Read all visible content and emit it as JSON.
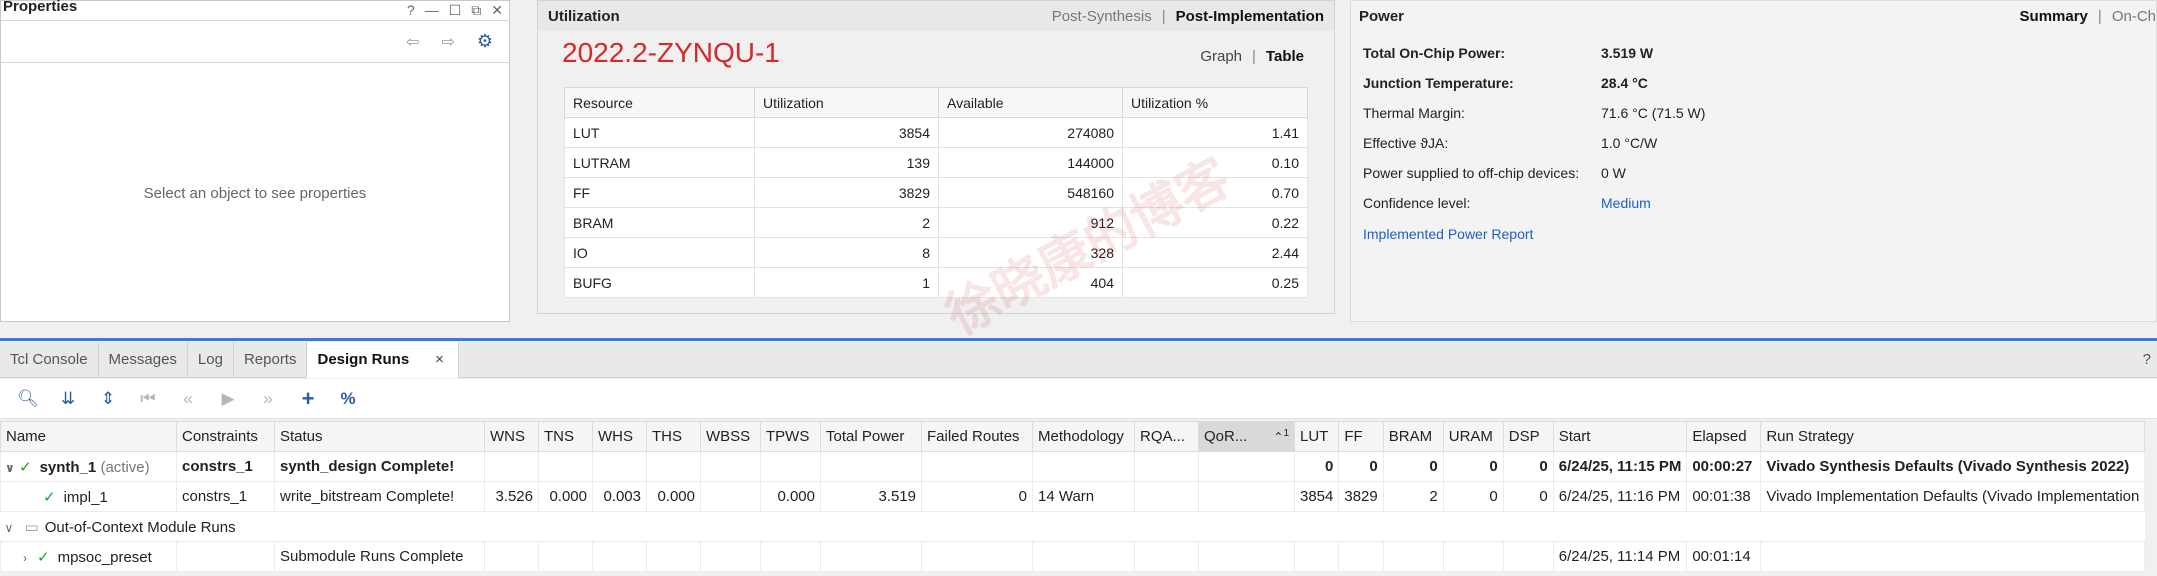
{
  "properties": {
    "title": "Properties",
    "window_controls": [
      "?",
      "—",
      "☐",
      "⧉",
      "✕"
    ],
    "empty_message": "Select an object to see properties"
  },
  "utilization": {
    "title": "Utilization",
    "modes": [
      "Post-Synthesis",
      "Post-Implementation"
    ],
    "device": "2022.2-ZYNQU-1",
    "views": [
      "Graph",
      "Table"
    ],
    "columns": [
      "Resource",
      "Utilization",
      "Available",
      "Utilization %"
    ],
    "rows": [
      [
        "LUT",
        "3854",
        "274080",
        "1.41"
      ],
      [
        "LUTRAM",
        "139",
        "144000",
        "0.10"
      ],
      [
        "FF",
        "3829",
        "548160",
        "0.70"
      ],
      [
        "BRAM",
        "2",
        "912",
        "0.22"
      ],
      [
        "IO",
        "8",
        "328",
        "2.44"
      ],
      [
        "BUFG",
        "1",
        "404",
        "0.25"
      ]
    ]
  },
  "power": {
    "title": "Power",
    "views": [
      "Summary",
      "On-Ch"
    ],
    "rows": [
      {
        "k": "Total On-Chip Power:",
        "v": "3.519 W",
        "bold": true
      },
      {
        "k": "Junction Temperature:",
        "v": "28.4 °C",
        "bold": true
      },
      {
        "k": "Thermal Margin:",
        "v": "71.6 °C (71.5 W)"
      },
      {
        "k": "Effective ϑJA:",
        "v": "1.0 °C/W"
      },
      {
        "k": "Power supplied to off-chip devices:",
        "v": "0 W"
      },
      {
        "k": "Confidence level:",
        "v": "Medium",
        "link": true
      }
    ],
    "report_link": "Implemented Power Report"
  },
  "tabs": [
    "Tcl Console",
    "Messages",
    "Log",
    "Reports",
    "Design Runs"
  ],
  "tab_close": "×",
  "help": "?",
  "runs": {
    "columns": [
      "Name",
      "Constraints",
      "Status",
      "WNS",
      "TNS",
      "WHS",
      "THS",
      "WBSS",
      "TPWS",
      "Total Power",
      "Failed Routes",
      "Methodology",
      "RQA...",
      "QoR...",
      "LUT",
      "FF",
      "BRAM",
      "URAM",
      "DSP",
      "Start",
      "Elapsed",
      "Run Strategy"
    ],
    "qor_badge": "1",
    "synth": {
      "name": "synth_1",
      "tag": "(active)",
      "cells": [
        "constrs_1",
        "synth_design Complete!",
        "",
        "",
        "",
        "",
        "",
        "",
        "",
        "",
        "",
        "",
        "",
        "0",
        "0",
        "0",
        "0",
        "0",
        "6/24/25, 11:15 PM",
        "00:00:27",
        "Vivado Synthesis Defaults (Vivado Synthesis 2022)"
      ]
    },
    "impl": {
      "name": "impl_1",
      "cells": [
        "constrs_1",
        "write_bitstream Complete!",
        "3.526",
        "0.000",
        "0.003",
        "0.000",
        "",
        "0.000",
        "3.519",
        "0",
        "14 Warn",
        "",
        "",
        "3854",
        "3829",
        "2",
        "0",
        "0",
        "6/24/25, 11:16 PM",
        "00:01:38",
        "Vivado Implementation Defaults (Vivado Implementation"
      ]
    },
    "group": "Out-of-Context Module Runs",
    "ooc": {
      "name": "mpsoc_preset",
      "cells": [
        "",
        "Submodule Runs Complete",
        "",
        "",
        "",
        "",
        "",
        "",
        "",
        "",
        "",
        "",
        "",
        "",
        "",
        "",
        "",
        "",
        "6/24/25, 11:14 PM",
        "00:01:14",
        ""
      ]
    }
  },
  "watermark": "徐晓康的博客"
}
